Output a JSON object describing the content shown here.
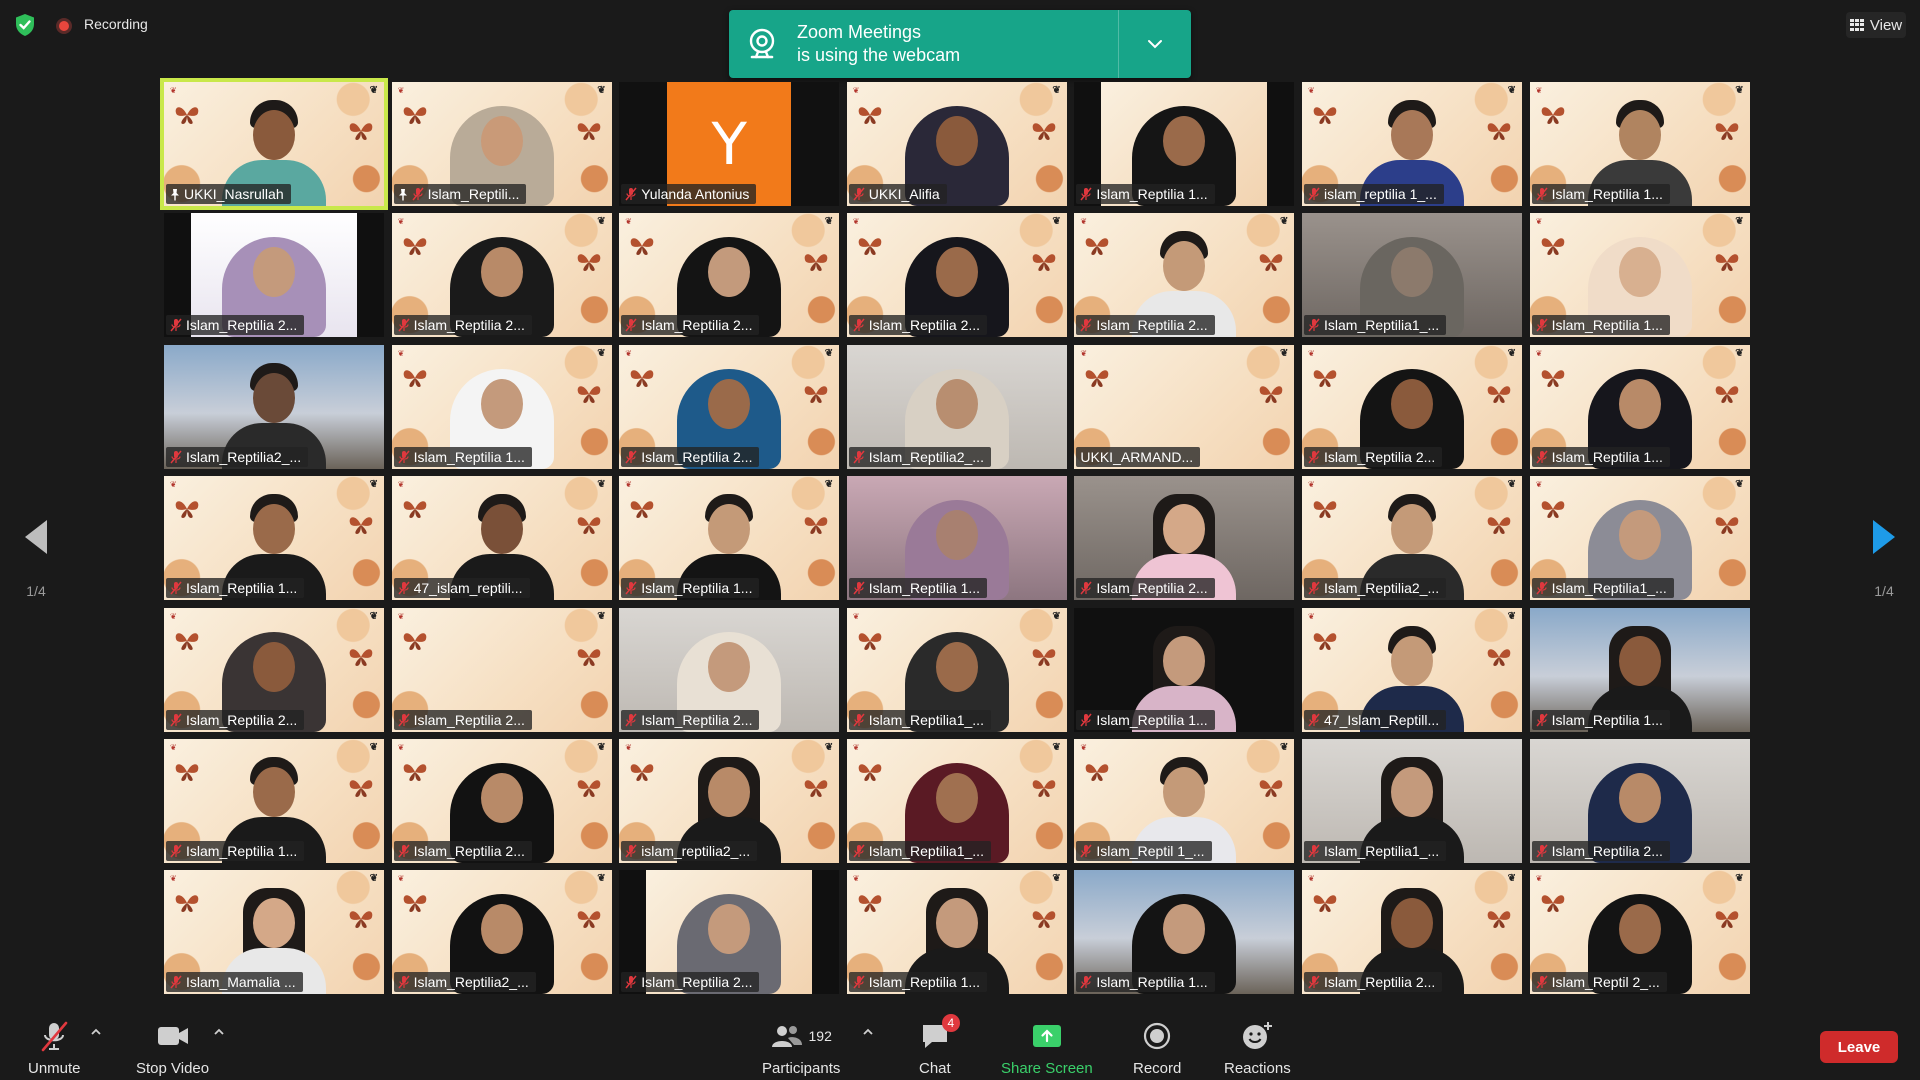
{
  "topbar": {
    "recording_label": "Recording",
    "view_label": "View"
  },
  "webcam_banner": {
    "line1": "Zoom Meetings",
    "line2": "is using the webcam"
  },
  "tiles": [
    {
      "name": "UKKI_Nasrullah",
      "bg": "ubaya",
      "active": true,
      "pinned": true,
      "muted": false,
      "look": "man",
      "skin": "#8a5a3c",
      "cloth": "#5aa8a0"
    },
    {
      "name": "Islam_Reptili...",
      "bg": "ubaya",
      "pinned": true,
      "muted": true,
      "look": "hijab",
      "skin": "#c99a78",
      "cloth": "#b9ab98"
    },
    {
      "name": "Yulanda Antonius",
      "bg": "orange",
      "muted": true,
      "avatar_letter": "Y"
    },
    {
      "name": "UKKI_Alifia",
      "bg": "ubaya",
      "muted": true,
      "look": "hijab",
      "skin": "#8a5a3c",
      "cloth": "#2a2838"
    },
    {
      "name": "Islam_Reptilia 1...",
      "bg": "letterbox",
      "muted": true,
      "look": "hijab",
      "skin": "#9a6a4a",
      "cloth": "#151515"
    },
    {
      "name": "islam_reptilia 1_...",
      "bg": "ubaya",
      "muted": true,
      "look": "man",
      "skin": "#a87858",
      "cloth": "#2c3e8a"
    },
    {
      "name": "Islam_Reptilia 1...",
      "bg": "ubaya",
      "muted": true,
      "look": "man",
      "skin": "#b08460",
      "cloth": "#3a3a3a"
    },
    {
      "name": "Islam_Reptilia 2...",
      "bg": "letterbox-white",
      "muted": true,
      "look": "hijab",
      "skin": "#c49a7c",
      "cloth": "#a790b8"
    },
    {
      "name": "Islam_Reptilia 2...",
      "bg": "ubaya",
      "muted": true,
      "look": "hijab",
      "skin": "#b88a68",
      "cloth": "#1a1a1a"
    },
    {
      "name": "Islam_Reptilia 2...",
      "bg": "ubaya",
      "muted": true,
      "look": "hijab",
      "skin": "#c39a7c",
      "cloth": "#141414"
    },
    {
      "name": "Islam_Reptilia 2...",
      "bg": "ubaya",
      "muted": true,
      "look": "hijab",
      "skin": "#9a6a4a",
      "cloth": "#16161c"
    },
    {
      "name": "Islam_Reptilia 2...",
      "bg": "ubaya",
      "muted": true,
      "look": "man",
      "skin": "#c49a78",
      "cloth": "#e8e8e8"
    },
    {
      "name": "Islam_Reptilia1_...",
      "bg": "dim",
      "muted": true,
      "look": "hijab",
      "skin": "#8c7a6c",
      "cloth": "#6a6660"
    },
    {
      "name": "Islam_Reptilia 1...",
      "bg": "ubaya",
      "muted": true,
      "look": "hijab",
      "skin": "#d8b090",
      "cloth": "#f0dcc8"
    },
    {
      "name": "Islam_Reptilia2_...",
      "bg": "room",
      "muted": true,
      "look": "man",
      "skin": "#6a4a38",
      "cloth": "#2a2a2a"
    },
    {
      "name": "Islam_Reptilia 1...",
      "bg": "ubaya",
      "muted": true,
      "look": "hijab",
      "skin": "#c49a7c",
      "cloth": "#f4f4f4"
    },
    {
      "name": "Islam_Reptilia 2...",
      "bg": "ubaya",
      "muted": true,
      "look": "hijab",
      "skin": "#9a6a4a",
      "cloth": "#1e5a8a"
    },
    {
      "name": "Islam_Reptilia2_...",
      "bg": "wall",
      "muted": true,
      "look": "hijab",
      "skin": "#b88e70",
      "cloth": "#d8d0c4"
    },
    {
      "name": "UKKI_ARMAND...",
      "bg": "ubaya",
      "muted": false,
      "look": "none"
    },
    {
      "name": "Islam_Reptilia 2...",
      "bg": "ubaya",
      "muted": true,
      "look": "hijab",
      "skin": "#8a5a3c",
      "cloth": "#141414"
    },
    {
      "name": "Islam_Reptilia 1...",
      "bg": "ubaya",
      "muted": true,
      "look": "hijab",
      "skin": "#b88a68",
      "cloth": "#16161c"
    },
    {
      "name": "Islam_Reptilia 1...",
      "bg": "ubaya",
      "muted": true,
      "look": "man",
      "skin": "#9a6a4a",
      "cloth": "#1a1a1a"
    },
    {
      "name": "47_islam_reptili...",
      "bg": "ubaya",
      "muted": true,
      "look": "man",
      "skin": "#7a5038",
      "cloth": "#1a1a1a"
    },
    {
      "name": "Islam_Reptilia 1...",
      "bg": "ubaya",
      "muted": true,
      "look": "man",
      "skin": "#c49a78",
      "cloth": "#141414"
    },
    {
      "name": "Islam_Reptilia 1...",
      "bg": "pink",
      "muted": true,
      "look": "hijab",
      "skin": "#a88070",
      "cloth": "#9a7a98"
    },
    {
      "name": "Islam_Reptilia 2...",
      "bg": "dim",
      "muted": true,
      "look": "woman",
      "skin": "#d4a888",
      "cloth": "#efc4d4"
    },
    {
      "name": "Islam_Reptilia2_...",
      "bg": "ubaya",
      "muted": true,
      "look": "man",
      "skin": "#c49a78",
      "cloth": "#2a2a2a"
    },
    {
      "name": "Islam_Reptilia1_...",
      "bg": "ubaya",
      "muted": true,
      "look": "hijab",
      "skin": "#c49a7c",
      "cloth": "#8c8c96"
    },
    {
      "name": "Islam_Reptilia 2...",
      "bg": "ubaya",
      "muted": true,
      "look": "hijab",
      "skin": "#8a5a3c",
      "cloth": "#3a3434"
    },
    {
      "name": "Islam_Reptilia 2...",
      "bg": "ubaya",
      "muted": true,
      "look": "none"
    },
    {
      "name": "Islam_Reptilia 2...",
      "bg": "wall",
      "muted": true,
      "look": "hijab",
      "skin": "#c49a7c",
      "cloth": "#e8e0d4"
    },
    {
      "name": "Islam_Reptilia1_...",
      "bg": "ubaya",
      "muted": true,
      "look": "hijab",
      "skin": "#9a6a4a",
      "cloth": "#2a2a2a"
    },
    {
      "name": "Islam_Reptilia 1...",
      "bg": "dark",
      "muted": true,
      "look": "woman",
      "skin": "#c49a7c",
      "cloth": "#d8b4c8"
    },
    {
      "name": "47_Islam_Reptill...",
      "bg": "ubaya",
      "muted": true,
      "look": "man",
      "skin": "#c49a78",
      "cloth": "#1e2a4a"
    },
    {
      "name": "Islam_Reptilia 1...",
      "bg": "room",
      "muted": true,
      "look": "woman",
      "skin": "#8a5a3c",
      "cloth": "#1a1a1a"
    },
    {
      "name": "Islam_Reptilia 1...",
      "bg": "ubaya",
      "muted": true,
      "look": "man",
      "skin": "#9a6a4a",
      "cloth": "#1a1a1a"
    },
    {
      "name": "Islam_Reptilia 2...",
      "bg": "ubaya",
      "muted": true,
      "look": "hijab",
      "skin": "#b88a68",
      "cloth": "#121212"
    },
    {
      "name": "islam_reptilia2_...",
      "bg": "ubaya",
      "muted": true,
      "look": "woman",
      "skin": "#b88a68",
      "cloth": "#1a1a1a"
    },
    {
      "name": "Islam_Reptilia1_...",
      "bg": "ubaya",
      "muted": true,
      "look": "hijab",
      "skin": "#a07050",
      "cloth": "#5a1a24"
    },
    {
      "name": "Islam_Reptil 1_...",
      "bg": "ubaya",
      "muted": true,
      "look": "man",
      "skin": "#c49a78",
      "cloth": "#e8e8ec"
    },
    {
      "name": "Islam_Reptilia1_...",
      "bg": "wall",
      "muted": true,
      "look": "woman",
      "skin": "#c49a7c",
      "cloth": "#1a1a1a"
    },
    {
      "name": "Islam_Reptilia 2...",
      "bg": "wall",
      "muted": true,
      "look": "hijab",
      "skin": "#b88a68",
      "cloth": "#1e2a4a"
    },
    {
      "name": "Islam_Mamalia ...",
      "bg": "ubaya",
      "muted": true,
      "look": "woman",
      "skin": "#d4a888",
      "cloth": "#e8e8e8"
    },
    {
      "name": "Islam_Reptilia2_...",
      "bg": "ubaya",
      "muted": true,
      "look": "hijab",
      "skin": "#b88a68",
      "cloth": "#121212"
    },
    {
      "name": "Islam_Reptilia 2...",
      "bg": "letterbox",
      "muted": true,
      "look": "hijab",
      "skin": "#c49a7c",
      "cloth": "#6a6a72"
    },
    {
      "name": "Islam_Reptilia 1...",
      "bg": "ubaya",
      "muted": true,
      "look": "woman",
      "skin": "#c49a7c",
      "cloth": "#1a1a1a"
    },
    {
      "name": "Islam_Reptilia 1...",
      "bg": "room",
      "muted": true,
      "look": "hijab",
      "skin": "#c49a7c",
      "cloth": "#141414"
    },
    {
      "name": "Islam_Reptilia 2...",
      "bg": "ubaya",
      "muted": true,
      "look": "woman",
      "skin": "#8a5a3c",
      "cloth": "#1a1a1a"
    },
    {
      "name": "Islam_Reptil 2_...",
      "bg": "ubaya",
      "muted": true,
      "look": "hijab",
      "skin": "#9a6a4a",
      "cloth": "#141414"
    }
  ],
  "page_nav": {
    "page_indicator": "1/4"
  },
  "toolbar": {
    "unmute_label": "Unmute",
    "stop_video_label": "Stop Video",
    "participants_label": "Participants",
    "participants_count": "192",
    "chat_label": "Chat",
    "chat_badge": "4",
    "share_screen_label": "Share Screen",
    "record_label": "Record",
    "reactions_label": "Reactions",
    "leave_label": "Leave"
  },
  "colors": {
    "banner": "#17a589",
    "active_speaker": "#c9e84a",
    "share_green": "#3ad06a",
    "leave_red": "#cf2b2b",
    "nav_arrow": "#1e9be8"
  }
}
